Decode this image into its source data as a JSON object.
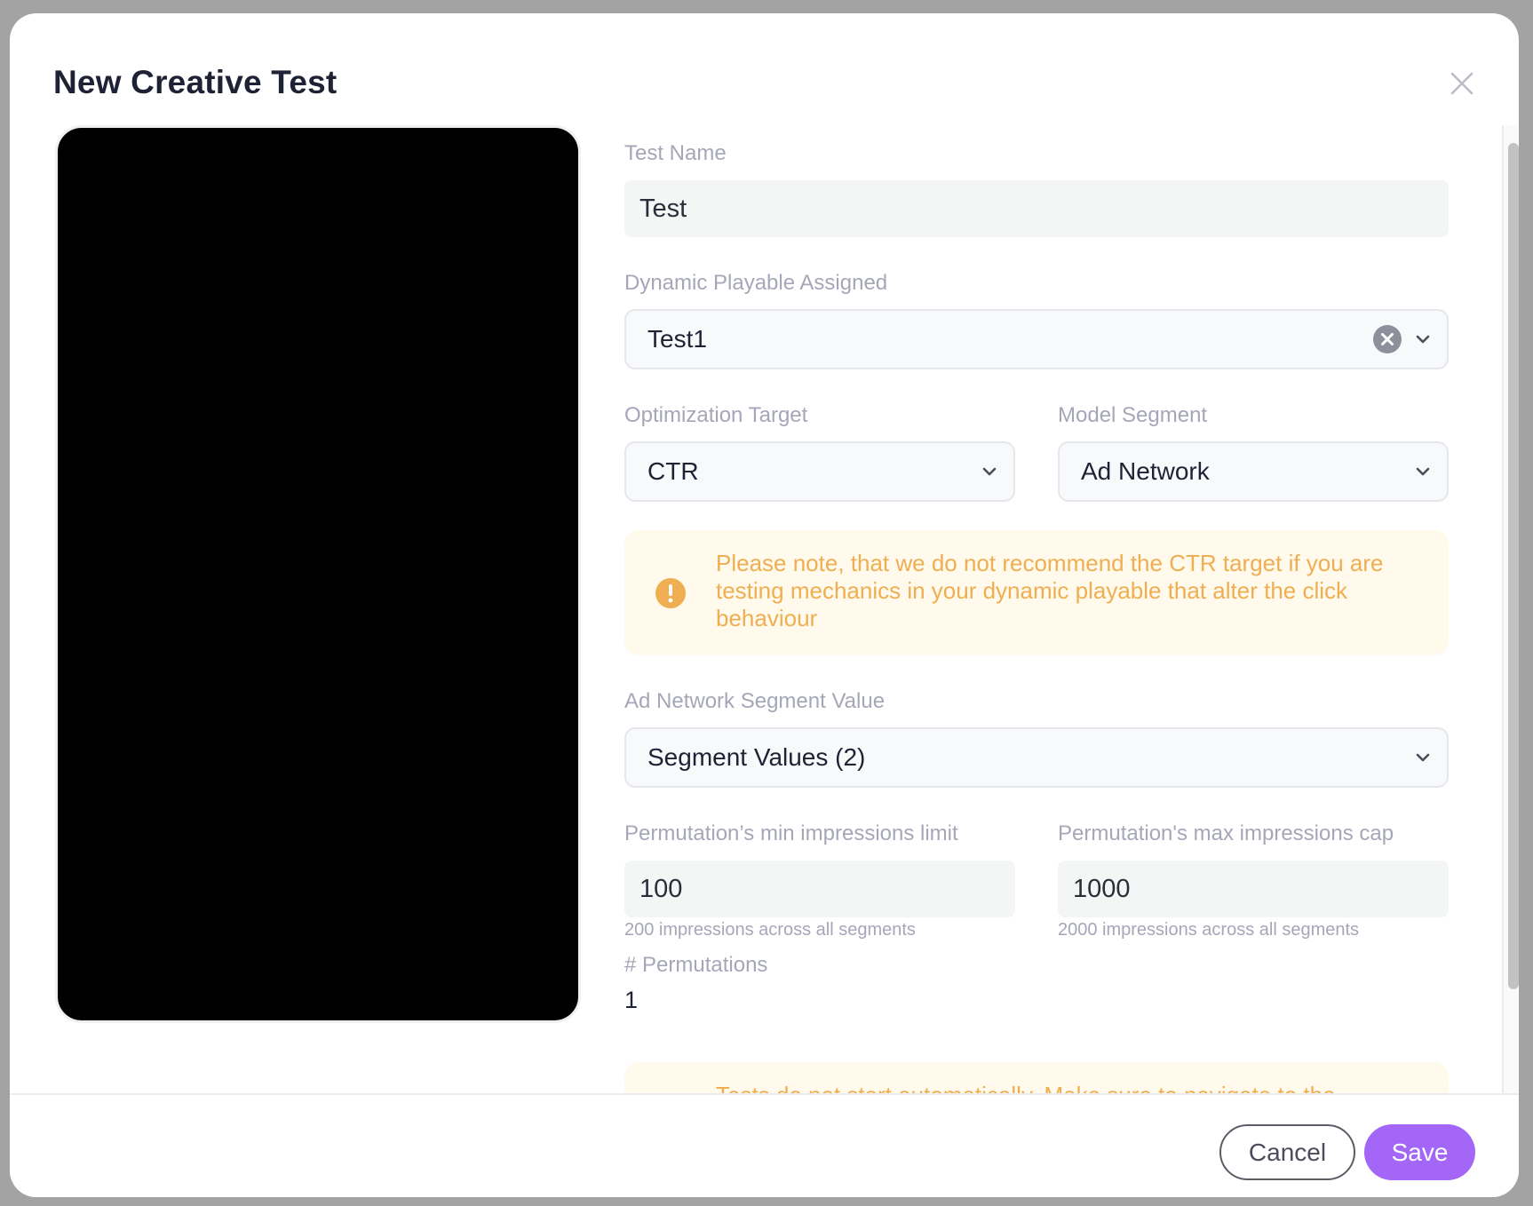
{
  "modal": {
    "title": "New Creative Test"
  },
  "form": {
    "test_name": {
      "label": "Test Name",
      "value": "Test"
    },
    "dynamic_playable": {
      "label": "Dynamic Playable Assigned",
      "value": "Test1"
    },
    "optimization_target": {
      "label": "Optimization Target",
      "value": "CTR"
    },
    "model_segment": {
      "label": "Model Segment",
      "value": "Ad Network"
    },
    "ctr_note": {
      "text": "Please note, that we do not recommend the CTR target if you are testing mechanics in your dynamic playable that alter the click behaviour"
    },
    "segment_value": {
      "label": "Ad Network Segment Value",
      "value": "Segment Values (2)"
    },
    "min_impressions": {
      "label": "Permutation’s min impressions limit",
      "value": "100",
      "hint": "200 impressions across all segments"
    },
    "max_impressions": {
      "label": "Permutation's max impressions cap",
      "value": "1000",
      "hint": "2000 impressions across all segments"
    },
    "permutations": {
      "label": "# Permutations",
      "value": "1"
    },
    "start_note": {
      "text": "Tests do not start automatically. Make sure to navigate to the"
    }
  },
  "footer": {
    "cancel_label": "Cancel",
    "save_label": "Save"
  },
  "colors": {
    "accent": "#a366f7",
    "warning": "#f0ae52",
    "warning_bg": "#fffaec"
  }
}
